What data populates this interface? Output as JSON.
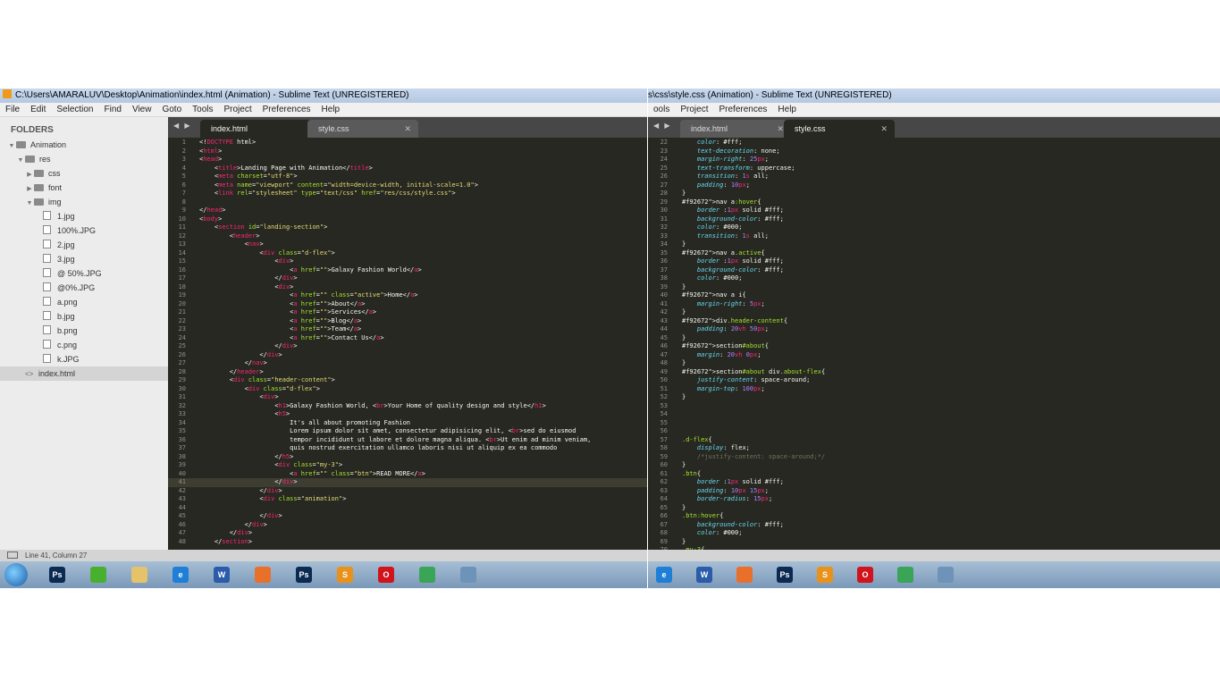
{
  "left_window": {
    "title": "C:\\Users\\AMARALUV\\Desktop\\Animation\\index.html (Animation) - Sublime Text (UNREGISTERED)",
    "menu": [
      "File",
      "Edit",
      "Selection",
      "Find",
      "View",
      "Goto",
      "Tools",
      "Project",
      "Preferences",
      "Help"
    ],
    "sidebar": {
      "header": "FOLDERS",
      "items": [
        {
          "label": "Animation",
          "kind": "folder",
          "depth": 0,
          "open": true
        },
        {
          "label": "res",
          "kind": "folder",
          "depth": 1,
          "open": true
        },
        {
          "label": "css",
          "kind": "folder",
          "depth": 2,
          "open": false
        },
        {
          "label": "font",
          "kind": "folder",
          "depth": 2,
          "open": false
        },
        {
          "label": "img",
          "kind": "folder",
          "depth": 2,
          "open": true
        },
        {
          "label": "1.jpg",
          "kind": "file",
          "depth": 3
        },
        {
          "label": "100%.JPG",
          "kind": "file",
          "depth": 3
        },
        {
          "label": "2.jpg",
          "kind": "file",
          "depth": 3
        },
        {
          "label": "3.jpg",
          "kind": "file",
          "depth": 3
        },
        {
          "label": "@ 50%.JPG",
          "kind": "file",
          "depth": 3
        },
        {
          "label": "@0%.JPG",
          "kind": "file",
          "depth": 3
        },
        {
          "label": "a.png",
          "kind": "file",
          "depth": 3
        },
        {
          "label": "b.jpg",
          "kind": "file",
          "depth": 3
        },
        {
          "label": "b.png",
          "kind": "file",
          "depth": 3
        },
        {
          "label": "c.png",
          "kind": "file",
          "depth": 3
        },
        {
          "label": "k.JPG",
          "kind": "file",
          "depth": 3
        },
        {
          "label": "index.html",
          "kind": "code",
          "depth": 1,
          "selected": true
        }
      ]
    },
    "tabs": [
      {
        "label": "index.html",
        "active": true
      },
      {
        "label": "style.css",
        "active": false
      }
    ],
    "first_line": 1,
    "current_line": 41,
    "code": [
      "<!DOCTYPE html>",
      "<html>",
      "<head>",
      "    <title>Landing Page with Animation</title>",
      "    <meta charset=\"utf-8\">",
      "    <meta name=\"viewport\" content=\"width=device-width, initial-scale=1.0\">",
      "    <link rel=\"stylesheet\" type=\"text/css\" href=\"res/css/style.css\">",
      "",
      "</head>",
      "<body>",
      "    <section id=\"landing-section\">",
      "        <header>",
      "            <nav>",
      "                <div class=\"d-flex\">",
      "                    <div>",
      "                        <a href=\"\">Galaxy Fashion World</a>",
      "                    </div>",
      "                    <div>",
      "                        <a href=\"\" class=\"active\">Home</a>",
      "                        <a href=\"\">About</a>",
      "                        <a href=\"\">Services</a>",
      "                        <a href=\"\">Blog</a>",
      "                        <a href=\"\">Team</a>",
      "                        <a href=\"\">Contact Us</a>",
      "                    </div>",
      "                </div>",
      "            </nav>",
      "        </header>",
      "        <div class=\"header-content\">",
      "            <div class=\"d-flex\">",
      "                <div>",
      "                    <h1>Galaxy Fashion World, <br>Your Home of quality design and style</h1>",
      "                    <h5>",
      "                        It's all about promoting Fashion",
      "                        Lorem ipsum dolor sit amet, consectetur adipisicing elit, <br>sed do eiusmod",
      "                        tempor incididunt ut labore et dolore magna aliqua. <br>Ut enim ad minim veniam,",
      "                        quis nostrud exercitation ullamco laboris nisi ut aliquip ex ea commodo",
      "                    </h5>",
      "                    <div class=\"my-3\">",
      "                        <a href=\"\" class=\"btn\">READ MORE</a>",
      "                    </div>",
      "                </div>",
      "                <div class=\"animation\">",
      "",
      "                </div>",
      "            </div>",
      "        </div>",
      "    </section>"
    ],
    "status": "Line 41, Column 27"
  },
  "right_window": {
    "title": "s\\css\\style.css (Animation) - Sublime Text (UNREGISTERED)",
    "menu": [
      "ools",
      "Project",
      "Preferences",
      "Help"
    ],
    "tabs": [
      {
        "label": "index.html",
        "active": false
      },
      {
        "label": "style.css",
        "active": true
      }
    ],
    "first_line": 22,
    "code": [
      "    color: #fff;",
      "    text-decoration: none;",
      "    margin-right: 25px;",
      "    text-transform: uppercase;",
      "    transition: 1s all;",
      "    padding: 10px;",
      "}",
      "nav a:hover{",
      "    border :1px solid #fff;",
      "    background-color: #fff;",
      "    color: #000;",
      "    transition: 1s all;",
      "}",
      "nav a.active{",
      "    border :1px solid #fff;",
      "    background-color: #fff;",
      "    color: #000;",
      "}",
      "nav a i{",
      "    margin-right: 5px;",
      "}",
      "div.header-content{",
      "    padding: 20vh 50px;",
      "}",
      "section#about{",
      "    margin: 20vh 0px;",
      "}",
      "section#about div.about-flex{",
      "    justify-content: space-around;",
      "    margin-top: 100px;",
      "}",
      "",
      "",
      "",
      "",
      ".d-flex{",
      "    display: flex;",
      "    /*justify-content: space-around;*/",
      "}",
      ".btn{",
      "    border :1px solid #fff;",
      "    padding: 10px 15px;",
      "    border-radius: 15px;",
      "}",
      ".btn:hover{",
      "    background-color: #fff;",
      "    color: #000;",
      "}",
      ".my-3{"
    ]
  },
  "taskbar_left": [
    {
      "name": "photoshop-icon",
      "glyph": "Ps",
      "color": "#0a2a52"
    },
    {
      "name": "green-app-icon",
      "glyph": "",
      "color": "#49b02f"
    },
    {
      "name": "file-explorer-icon",
      "glyph": "",
      "color": "#e4c36a"
    },
    {
      "name": "internet-explorer-icon",
      "glyph": "e",
      "color": "#1f7fd6"
    },
    {
      "name": "word-icon",
      "glyph": "W",
      "color": "#2b5caa"
    },
    {
      "name": "firefox-icon",
      "glyph": "",
      "color": "#e8702a"
    },
    {
      "name": "photoshop-icon-2",
      "glyph": "Ps",
      "color": "#0a2a52"
    },
    {
      "name": "sublime-text-icon",
      "glyph": "S",
      "color": "#e8921c"
    },
    {
      "name": "opera-icon",
      "glyph": "O",
      "color": "#d1141c"
    },
    {
      "name": "chrome-icon",
      "glyph": "",
      "color": "#3aa457"
    },
    {
      "name": "remote-desktop-icon",
      "glyph": "",
      "color": "#6e93b8"
    }
  ],
  "taskbar_right": [
    {
      "name": "internet-explorer-icon",
      "glyph": "e",
      "color": "#1f7fd6"
    },
    {
      "name": "word-icon",
      "glyph": "W",
      "color": "#2b5caa"
    },
    {
      "name": "firefox-icon",
      "glyph": "",
      "color": "#e8702a"
    },
    {
      "name": "photoshop-icon",
      "glyph": "Ps",
      "color": "#0a2a52"
    },
    {
      "name": "sublime-text-icon",
      "glyph": "S",
      "color": "#e8921c"
    },
    {
      "name": "opera-icon",
      "glyph": "O",
      "color": "#d1141c"
    },
    {
      "name": "chrome-icon",
      "glyph": "",
      "color": "#3aa457"
    },
    {
      "name": "remote-desktop-icon",
      "glyph": "",
      "color": "#6e93b8"
    }
  ]
}
